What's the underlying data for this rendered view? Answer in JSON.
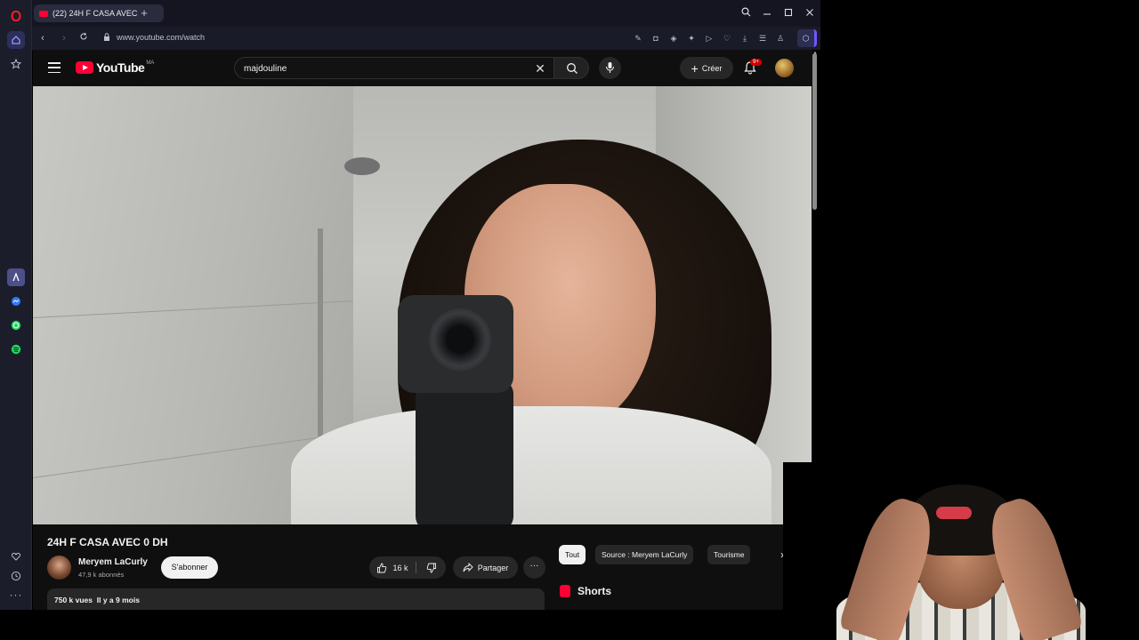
{
  "browser": {
    "tab": {
      "title": "(22) 24H F CASA AVEC"
    },
    "new_tab_icon": "plus-icon",
    "window_controls": [
      "search-icon",
      "minimize-icon",
      "maximize-icon",
      "close-icon"
    ],
    "address": {
      "url": "www.youtube.com/watch"
    },
    "sidebar_icons": [
      "opera-logo-icon",
      "home-icon",
      "star-icon",
      "aria-icon",
      "messenger-icon",
      "whatsapp-icon",
      "spotify-icon",
      "heart-icon",
      "history-icon",
      "more-icon"
    ]
  },
  "youtube": {
    "logo_text": "YouTube",
    "country_code": "MA",
    "search": {
      "value": "majdouline"
    },
    "create_label": "Créer",
    "notifications_badge": "9+",
    "video": {
      "title": "24H F CASA AVEC 0 DH",
      "channel": "Meryem LaCurly",
      "subscribers": "47,9 k abonnés",
      "subscribe_label": "S'abonner",
      "likes": "16 k",
      "share_label": "Partager",
      "more_label": "···",
      "stats": "750 k vues  Il y a 9 mois"
    },
    "chips": [
      {
        "label": "Tout",
        "selected": true
      },
      {
        "label": "Source : Meryem LaCurly",
        "selected": false
      },
      {
        "label": "Tourisme",
        "selected": false
      }
    ],
    "shorts_label": "Shorts"
  },
  "colors": {
    "accent": "#ff0033",
    "opera_accent": "#6f56ff",
    "background": "#0f0f0f"
  }
}
